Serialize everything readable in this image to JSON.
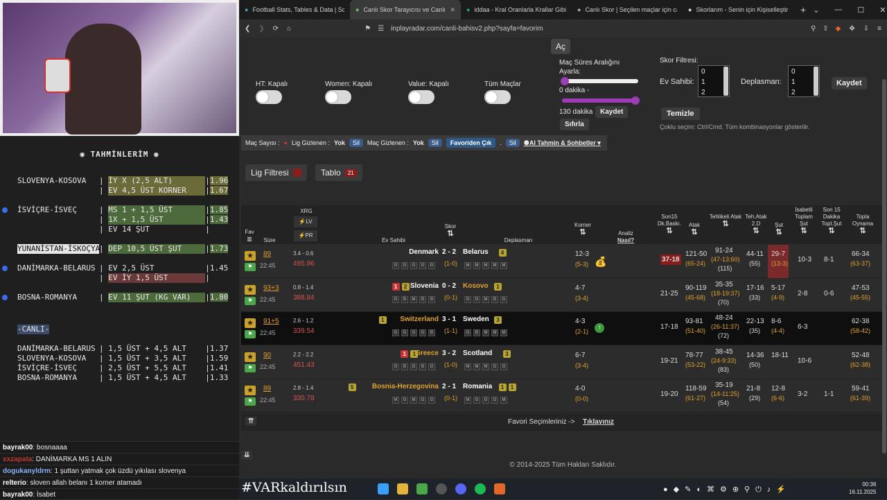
{
  "tips": {
    "title": "TAHMİNLERİM",
    "rows": [
      {
        "match": "SLOVENYA-KOSOVA",
        "bet": "İY X (2,5 ALT)",
        "odd": "1.96"
      },
      {
        "match": "",
        "bet": "EV 4,5 ÜST KORNER",
        "odd": "1.67"
      },
      {
        "match": "İSVİÇRE-İSVEÇ",
        "bet": "MS 1 + 1,5 ÜST",
        "odd": "1.85"
      },
      {
        "match": "",
        "bet": "1X + 1,5 ÜST",
        "odd": "1.43"
      },
      {
        "match": "",
        "bet": "EV 14 ŞUT",
        "odd": ""
      },
      {
        "match": "YUNANİSTAN-İSKOÇYA",
        "bet": "DEP 10,5 ÜST ŞUT",
        "odd": "1.73"
      },
      {
        "match": "DANİMARKA-BELARUS",
        "bet": "EV 2,5 ÜST",
        "odd": "1.45"
      },
      {
        "match": "",
        "bet": "EV İY 1,5 ÜST",
        "odd": ""
      },
      {
        "match": "BOSNA-ROMANYA",
        "bet": "EV 11 ŞUT (KG VAR)",
        "odd": "1.80"
      }
    ],
    "live_title": "-CANLI-",
    "live": [
      {
        "match": "DANİMARKA-BELARUS",
        "bet": "1,5 ÜST + 4,5 ALT",
        "odd": "1.37"
      },
      {
        "match": "SLOVENYA-KOSOVA",
        "bet": "1,5 ÜST + 3,5 ALT",
        "odd": "1.59"
      },
      {
        "match": "İSVİÇRE-İSVEÇ",
        "bet": "2,5 ÜST + 5,5 ALT",
        "odd": "1.41"
      },
      {
        "match": "BOSNA-ROMANYA",
        "bet": "1,5 ÜST + 4,5 ALT",
        "odd": "1.33"
      }
    ]
  },
  "chat": [
    {
      "user": "bayrak00",
      "msg": ": bosnaaaa",
      "color": "#ffffff"
    },
    {
      "user": "xxzapata",
      "msg": ": DANİMARKA MS 1 ALIN",
      "color": "#c0392b"
    },
    {
      "user": "dogukanyldrm",
      "msg": ": 1 şuttan yatmak çok üzdü yıkılası slovenya",
      "color": "#8ab4f8"
    },
    {
      "user": "relterio",
      "msg": ": sloven allah belanı 1 korner atamadı",
      "color": "#ffffff"
    },
    {
      "user": "bayrak00",
      "msg": ": İsabet",
      "color": "#ffffff"
    }
  ],
  "browser": {
    "tabs": [
      {
        "label": "Football Stats, Tables & Data | Socc",
        "active": false
      },
      {
        "label": "Canlı Skor Tarayıcısı ve Canlı Sk",
        "active": true
      },
      {
        "label": "iddaa - Kral Oranlarla Krallar Gibi K",
        "active": false
      },
      {
        "label": "Canlı Skor | Seçilen maçlar için canl",
        "active": false
      },
      {
        "label": "Skorlarım - Senin için Kişiselleştiri",
        "active": false
      }
    ],
    "url": "inplayradar.com/canli-bahisv2.php?sayfa=favorim"
  },
  "filters": {
    "ac": "Aç",
    "ht": "HT: Kapalı",
    "women": "Women: Kapalı",
    "value": "Value: Kapalı",
    "all": "Tüm Maçlar",
    "duration_title": "Maç Süres Aralığını Ayarla:",
    "min": "0 dakika -",
    "max": "130 dakika",
    "save": "Kaydet",
    "reset": "Sıfırla",
    "score_filter": "Skor Filtresi:",
    "home": "Ev Sahibi:",
    "away": "Deplasman:",
    "options": [
      "0",
      "1",
      "2"
    ],
    "save2": "Kaydet",
    "clear": "Temizle",
    "hint": "Çoklu seçim: Ctrl/Cmd. Tüm kombinasyonlar gösterilir."
  },
  "toolbar": {
    "match_count": "Maç Sayısı :",
    "lig_hidden": "Lig Gizlenen :",
    "lig_val": "Yok",
    "sil": "Sil",
    "mac_hidden": "Maç Gizlenen :",
    "mac_val": "Yok",
    "fav_out": "Favoriden Çık",
    "ai": "AI Tahmin & Sohbetler"
  },
  "buttons": {
    "lig": "Lig Filtresi",
    "tablo": "Tablo",
    "tablo_count": "21"
  },
  "headers": {
    "fav": "Fav",
    "sure": "Süre",
    "xrg": "XRG",
    "lv": "LV",
    "pr": "PR",
    "ev": "Ev Sahibi",
    "skor": "Skor",
    "dep": "Deplasman",
    "korner": "Korner",
    "analiz": "Analiz",
    "nasil": "Nasıl?",
    "son15": "Son15 Dk.Baskı.",
    "atak": "Atak",
    "tehlikeli": "Tehlikeli Atak",
    "teh2d": "Teh.Atak 2.D",
    "sut": "Şut",
    "isabetli": "İsabetli Toplam Şut",
    "son15sut": "Son 15 Dakika Topl.Şut",
    "topla": "Topla Oynama"
  },
  "matches": [
    {
      "min": "89",
      "time": "22:45",
      "xrg": "3.4 - 0.6",
      "pr": "495.96",
      "home": "Denmark",
      "hbadge": "",
      "hbadge2": "",
      "score": "2 - 2",
      "ht": "(1-0)",
      "away": "Belarus",
      "abadge": "4",
      "abadge2": "",
      "corner": "12-3",
      "corner_ht": "(5-3)",
      "son15": "37-18",
      "atak": "121-50",
      "atak2": "(65-24)",
      "teh": "91-24",
      "teh2": "(47-13:60)",
      "teh3": "(115)",
      "t2d": "44-11",
      "t2d2": "(55)",
      "sut": "29-7",
      "sut2": "(13-3)",
      "isabet": "10-3",
      "s15": "8-1",
      "topla": "66-34",
      "topla2": "(63-37)",
      "home_form": [
        "G",
        "G",
        "G",
        "G",
        "G"
      ],
      "away_form": [
        "M",
        "M",
        "M",
        "M",
        "M"
      ]
    },
    {
      "min": "93+3",
      "time": "22:45",
      "xrg": "0.8 - 1.4",
      "pr": "388.84",
      "home": "Slovenia",
      "hbadge": "1",
      "hbadge2": "2",
      "score": "0 - 2",
      "ht": "(0-1)",
      "away": "Kosovo",
      "abadge": "1",
      "abadge2": "",
      "corner": "4-7",
      "corner_ht": "(3-4)",
      "son15": "21-25",
      "atak": "90-119",
      "atak2": "(45-68)",
      "teh": "35-35",
      "teh2": "(18-19:37)",
      "teh3": "(70)",
      "t2d": "17-16",
      "t2d2": "(33)",
      "sut": "5-17",
      "sut2": "(4-9)",
      "isabet": "2-8",
      "s15": "0-6",
      "topla": "47-53",
      "topla2": "(45-55)",
      "home_form": [
        "G",
        "B",
        "M",
        "B",
        "B"
      ],
      "away_form": [
        "G",
        "G",
        "M",
        "B",
        "G"
      ]
    },
    {
      "min": "91+5",
      "time": "22:45",
      "xrg": "2.6 - 1.2",
      "pr": "339.54",
      "home": "Switzerland",
      "hbadge": "1",
      "hbadge2": "",
      "score": "3 - 1",
      "ht": "(1-1)",
      "away": "Sweden",
      "abadge": "3",
      "abadge2": "",
      "corner": "4-3",
      "corner_ht": "(2-1)",
      "son15": "17-18",
      "atak": "93-81",
      "atak2": "(51-40)",
      "teh": "48-24",
      "teh2": "(26-11:37)",
      "teh3": "(72)",
      "t2d": "22-13",
      "t2d2": "(35)",
      "sut": "8-6",
      "sut2": "(4-4)",
      "isabet": "6-3",
      "s15": "",
      "topla": "62-38",
      "topla2": "(58-42)",
      "home_form": [
        "G",
        "G",
        "G",
        "G",
        "B"
      ],
      "away_form": [
        "G",
        "B",
        "M",
        "M",
        "M"
      ]
    },
    {
      "min": "90",
      "time": "22:45",
      "xrg": "2.2 - 2.2",
      "pr": "451.43",
      "home": "Greece",
      "hbadge": "1",
      "hbadge2": "1",
      "score": "3 - 2",
      "ht": "(1-0)",
      "away": "Scotland",
      "abadge": "3",
      "abadge2": "",
      "corner": "6-7",
      "corner_ht": "(3-4)",
      "son15": "19-21",
      "atak": "78-77",
      "atak2": "(53-22)",
      "teh": "38-45",
      "teh2": "(24-9:33)",
      "teh3": "(83)",
      "t2d": "14-36",
      "t2d2": "(50)",
      "sut": "18-11",
      "sut2": "",
      "isabet": "10-6",
      "s15": "",
      "topla": "52-48",
      "topla2": "(62-38)",
      "home_form": [
        "G",
        "B",
        "G",
        "B",
        "G"
      ],
      "away_form": [
        "M",
        "M",
        "M",
        "G",
        "G"
      ]
    },
    {
      "min": "89",
      "time": "22:45",
      "xrg": "2.8 - 1.4",
      "pr": "330.78",
      "home": "Bosnia-Herzegovina",
      "hbadge": "5",
      "hbadge2": "",
      "score": "2 - 1",
      "ht": "(0-1)",
      "away": "Romania",
      "abadge": "1",
      "abadge2": "1",
      "corner": "4-0",
      "corner_ht": "(0-0)",
      "son15": "19-20",
      "atak": "118-59",
      "atak2": "(61-27)",
      "teh": "35-19",
      "teh2": "(14-11:25)",
      "teh3": "(54)",
      "t2d": "21-8",
      "t2d2": "(29)",
      "sut": "12-8",
      "sut2": "(6-6)",
      "isabet": "3-2",
      "s15": "1-1",
      "topla": "59-41",
      "topla2": "(61-39)",
      "home_form": [
        "M",
        "G",
        "M",
        "G",
        "G"
      ],
      "away_form": [
        "M",
        "G",
        "G",
        "G",
        "M"
      ]
    }
  ],
  "favori": {
    "text": "Favori Seçimleriniz ->",
    "link": "Tıklayınız"
  },
  "copyright": "© 2014-2025 Tüm Hakları Saklıdır.",
  "taskbar": {
    "overlay": "#VARkaldırılsın",
    "time": "00:36",
    "date": "16.11.2025"
  }
}
